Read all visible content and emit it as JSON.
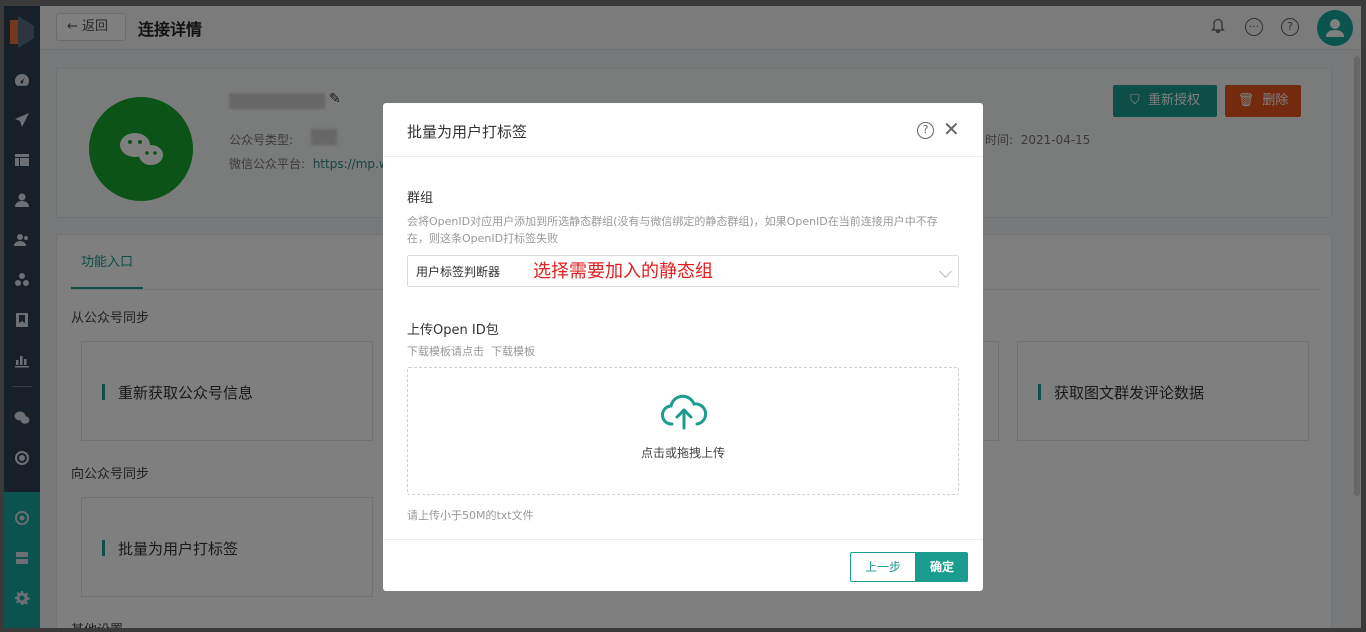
{
  "topbar": {
    "back_label": "返回",
    "page_title": "连接详情"
  },
  "account": {
    "type_label": "公众号类型:",
    "platform_label": "微信公众平台:",
    "platform_link": "https://mp.w",
    "time_label": "时间:",
    "time_value": "2021-04-15",
    "reauth_label": "重新授权",
    "delete_label": "删除"
  },
  "tabs": [
    {
      "label": "功能入口"
    }
  ],
  "sections": {
    "from_sync": "从公众号同步",
    "to_sync": "向公众号同步",
    "other": "其他设置"
  },
  "tiles": {
    "refresh_info": "重新获取公众号信息",
    "fetch_comments": "获取图文群发评论数据",
    "batch_tag": "批量为用户打标签"
  },
  "modal": {
    "title": "批量为用户打标签",
    "group_label": "群组",
    "group_hint": "会将OpenID对应用户添加到所选静态群组(没有与微信绑定的静态群组)，如果OpenID在当前连接用户中不存在，则这条OpenID打标签失败",
    "select_value": "用户标签判断器",
    "annotation": "选择需要加入的静态组",
    "upload_label": "上传Open ID包",
    "download_hint": "下载模板请点击",
    "download_link": "下载模板",
    "upload_text": "点击或拖拽上传",
    "upload_limit": "请上传小于50M的txt文件",
    "prev_label": "上一步",
    "ok_label": "确定"
  },
  "colors": {
    "accent": "#1a9c8e",
    "danger": "#e8541d",
    "wechat": "#17a72c",
    "sidebar": "#2f4050",
    "annotation": "#e02020"
  },
  "icons": {
    "sidebar": [
      "dashboard-icon",
      "send-icon",
      "layout-icon",
      "user-icon",
      "users-icon",
      "cluster-icon",
      "bookmark-icon",
      "bar-chart-icon",
      "wechat-icon",
      "target-icon",
      "hub-icon",
      "server-icon",
      "gear-icon"
    ],
    "top": [
      "bell-icon",
      "chat-icon",
      "help-icon",
      "avatar-icon"
    ]
  }
}
